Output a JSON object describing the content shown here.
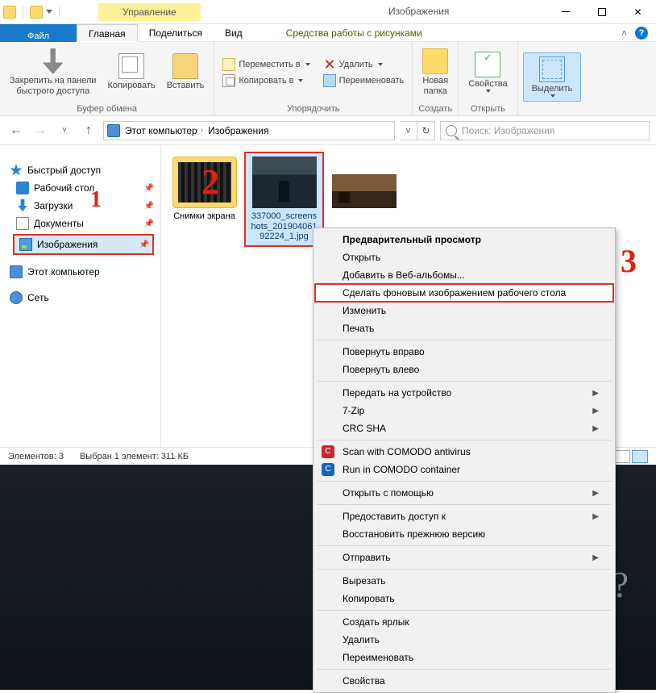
{
  "window": {
    "title": "Изображения",
    "manage_tab": "Управление",
    "contextual_group": "Средства работы с рисунками"
  },
  "tabs": {
    "file": "Файл",
    "home": "Главная",
    "share": "Поделиться",
    "view": "Вид"
  },
  "ribbon": {
    "clipboard": {
      "label": "Буфер обмена",
      "pin": "Закрепить на панели\nбыстрого доступа",
      "copy": "Копировать",
      "paste": "Вставить"
    },
    "organize": {
      "label": "Упорядочить",
      "move_to": "Переместить в",
      "copy_to": "Копировать в",
      "delete": "Удалить",
      "rename": "Переименовать"
    },
    "new": {
      "label": "Создать",
      "new_folder": "Новая\nпапка"
    },
    "open": {
      "label": "Открыть",
      "properties": "Свойства"
    },
    "select": {
      "label": "",
      "select_all": "Выделить"
    }
  },
  "nav": {
    "breadcrumb": {
      "root": "Этот компьютер",
      "current": "Изображения"
    },
    "search_placeholder": "Поиск: Изображения"
  },
  "navpane": {
    "quick_access": "Быстрый доступ",
    "desktop": "Рабочий стол",
    "downloads": "Загрузки",
    "documents": "Документы",
    "pictures": "Изображения",
    "this_pc": "Этот компьютер",
    "network": "Сеть"
  },
  "files": [
    {
      "name": "Снимки экрана"
    },
    {
      "name": "337000_screenshots_20190406192224_1.jpg"
    },
    {
      "name": ""
    }
  ],
  "status": {
    "count": "Элементов: 3",
    "selection": "Выбран 1 элемент: 311 КБ"
  },
  "context_menu": {
    "preview": "Предварительный просмотр",
    "open": "Открыть",
    "add_web_albums": "Добавить в Веб-альбомы...",
    "set_wallpaper": "Сделать фоновым изображением рабочего стола",
    "edit": "Изменить",
    "print": "Печать",
    "rotate_right": "Повернуть вправо",
    "rotate_left": "Повернуть влево",
    "cast": "Передать на устройство",
    "sevenzip": "7-Zip",
    "crcsha": "CRC SHA",
    "comodo_scan": "Scan with COMODO antivirus",
    "comodo_run": "Run in COMODO container",
    "open_with": "Открыть с помощью",
    "give_access": "Предоставить доступ к",
    "restore": "Восстановить прежнюю версию",
    "send_to": "Отправить",
    "cut": "Вырезать",
    "copy": "Копировать",
    "shortcut": "Создать ярлык",
    "delete": "Удалить",
    "rename": "Переименовать",
    "properties": "Свойства"
  },
  "annotations": {
    "one": "1",
    "two": "2",
    "three": "3"
  }
}
